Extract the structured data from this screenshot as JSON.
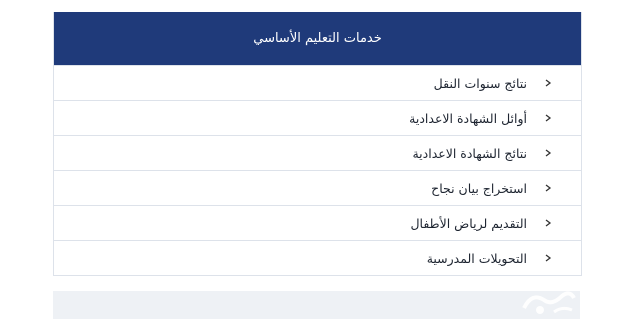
{
  "panel": {
    "header": "خدمات التعليم الأساسي",
    "items": [
      {
        "label": "نتائج سنوات النقل",
        "icon": "chevron-right-icon"
      },
      {
        "label": "أوائل الشهادة الاعدادية",
        "icon": "chevron-right-icon"
      },
      {
        "label": "نتائج الشهادة الاعدادية",
        "icon": "chevron-right-icon"
      },
      {
        "label": "استخراج بيان نجاح",
        "icon": "chevron-right-icon"
      },
      {
        "label": "التقديم لرياض الأطفال",
        "icon": "chevron-right-icon"
      },
      {
        "label": "التحويلات المدرسية",
        "icon": "chevron-right-icon"
      }
    ]
  },
  "colors": {
    "header_bg": "#1f3a7a",
    "header_text": "#ffffff",
    "border": "#dde2ea",
    "item_text": "#1d2430",
    "footer_band": "#eef1f5"
  }
}
